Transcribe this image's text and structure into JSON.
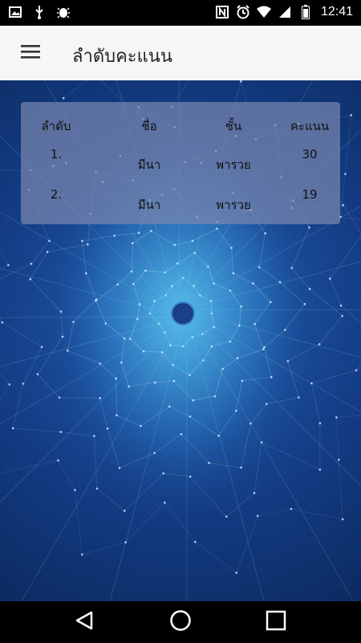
{
  "status_bar": {
    "time": "12:41",
    "left_icons": [
      "image-icon",
      "usb-icon",
      "bug-icon"
    ],
    "right_icons": [
      "nfc-icon",
      "alarm-icon",
      "wifi-icon",
      "signal-icon",
      "battery-icon"
    ]
  },
  "app_bar": {
    "title": "ลำดับคะแนน",
    "menu_icon": "menu-icon"
  },
  "table": {
    "headers": [
      "ลำดับ",
      "ชื่อ",
      "ชั้น",
      "คะแนน"
    ],
    "rows": [
      {
        "rank": "1.",
        "name": "มีนา",
        "class": "พารวย",
        "score": "30"
      },
      {
        "rank": "2.",
        "name": "มีนา",
        "class": "พารวย",
        "score": "19"
      }
    ]
  },
  "nav_bar": {
    "icons": [
      "back-icon",
      "home-icon",
      "recents-icon"
    ]
  },
  "colors": {
    "status_bar": "#000000",
    "app_bar": "#f6f6f6",
    "card": "#7887af",
    "background": "#133b82"
  }
}
